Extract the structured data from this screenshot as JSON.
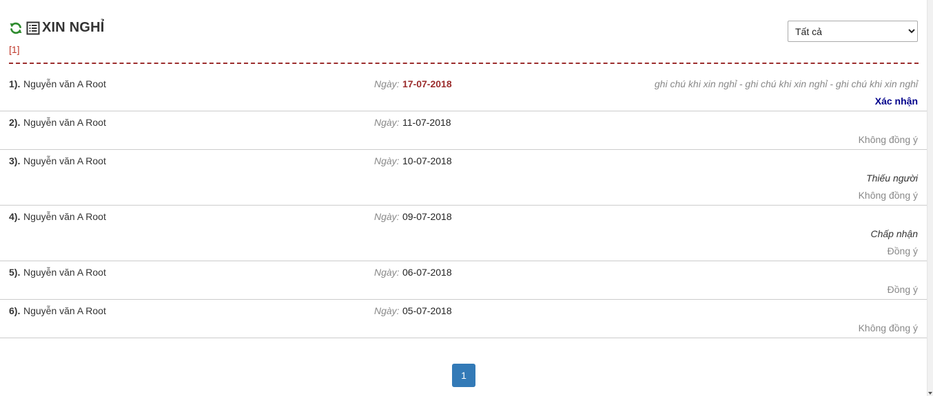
{
  "header": {
    "title": "XIN NGHỈ",
    "page_count": "[1]",
    "filter": {
      "selected": "Tất cả",
      "options": [
        "Tất cả"
      ]
    }
  },
  "labels": {
    "date_prefix": "Ngày:"
  },
  "rows": [
    {
      "num": "1).",
      "name": "Nguyễn văn A Root",
      "date": "17-07-2018",
      "note": "ghi chú khi xin nghỉ - ghi chú khi xin nghỉ - ghi chú khi xin nghỉ",
      "reason": "",
      "status": "Xác nhận"
    },
    {
      "num": "2).",
      "name": "Nguyễn văn A Root",
      "date": "11-07-2018",
      "note": "",
      "reason": "",
      "status": "Không đồng ý"
    },
    {
      "num": "3).",
      "name": "Nguyễn văn A Root",
      "date": "10-07-2018",
      "note": "",
      "reason": "Thiếu người",
      "status": "Không đồng ý"
    },
    {
      "num": "4).",
      "name": "Nguyễn văn A Root",
      "date": "09-07-2018",
      "note": "",
      "reason": "Chấp nhận",
      "status": "Đồng ý"
    },
    {
      "num": "5).",
      "name": "Nguyễn văn A Root",
      "date": "06-07-2018",
      "note": "",
      "reason": "",
      "status": "Đồng ý"
    },
    {
      "num": "6).",
      "name": "Nguyễn văn A Root",
      "date": "05-07-2018",
      "note": "",
      "reason": "",
      "status": "Không đồng ý"
    }
  ],
  "pagination": {
    "current": "1"
  },
  "colors": {
    "accent": "#337ab7",
    "highlight": "#9b2c2c",
    "icon_green": "#2e8b2e"
  }
}
